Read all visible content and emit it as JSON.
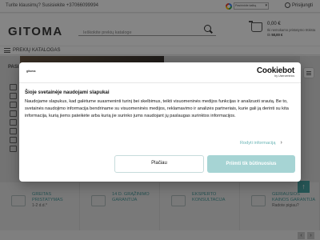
{
  "topbar": {
    "contact": "Turite klausimų? Susisiekite +37066099994",
    "language_select": "Pasirinkite kalbą",
    "login": "Prisijungti"
  },
  "header": {
    "logo": "GITOMA",
    "search_placeholder": "Ieškokite prekių kataloge",
    "cart_total": "0,00 €",
    "cart_note_prefix": "Iki nemokamo pristatymo trūksta tik ",
    "cart_note_amount": "50,00 €"
  },
  "nav": {
    "catalog_label": "PREKIŲ KATALOGAS"
  },
  "background": {
    "category_tab": "PASI",
    "features": [
      {
        "title_1": "GREITAS",
        "title_2": "PRISTATYMAS",
        "sub": "1-2 d.d.*"
      },
      {
        "title_1": "14 D. GRĄŽINIMO",
        "title_2": "GARANTIJA",
        "sub": ""
      },
      {
        "title_1": "EKSPERTO",
        "title_2": "KONSULTACIJA",
        "sub": ""
      },
      {
        "title_1": "GERIAUSIOS",
        "title_2": "KAINOS GARANTIJA",
        "sub": "Radote pigiau?"
      }
    ],
    "scroll_top_icon": "↑",
    "pager_prev": "‹",
    "pager_next": "›"
  },
  "cookie_dialog": {
    "site_logo": "gitoma",
    "brand_name": "Cookiebot",
    "brand_by": "by Usercentrics",
    "title": "Šioje svetainėje naudojami slapukai",
    "body": "Naudojame slapukus, kad galėtume suasmeninti turinį bei skelbimus, teikti visuomeninės medijos funkcijas ir analizuoti srautą. Be to, svetainės naudojimo informacija bendriname su visuomeninės medijos, reklamavimo ir analizės partneriais, kurie gali ją derinti su kita informacija, kurią jiems pateikėte arba kurią jie surinko jums naudojant jų paslaugas surinktos informacijos.",
    "details_link": "Rodyti informaciją",
    "details_chevron": "›",
    "more_button": "Plačiau",
    "allow_button": "Priimti tik būtinuosius"
  }
}
